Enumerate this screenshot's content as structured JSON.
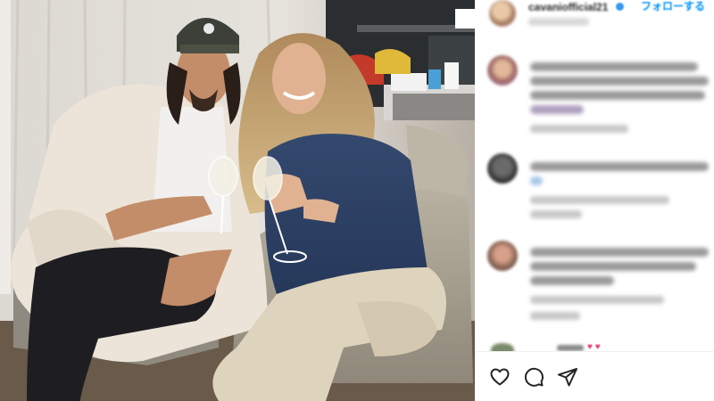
{
  "post": {
    "photo_alt": "",
    "username": "cavaniofficial21",
    "follow_label": "フォローする",
    "verified": true
  },
  "comments": [
    {
      "text": "",
      "meta": ""
    },
    {
      "text": "",
      "meta": ""
    },
    {
      "text": "",
      "meta": ""
    },
    {
      "text": "",
      "meta": ""
    }
  ],
  "reaction_emoji": "♥ ♥",
  "actions": {
    "like_icon": "heart-icon",
    "comment_icon": "speech-bubble-icon",
    "share_icon": "paper-plane-icon"
  },
  "colors": {
    "accent": "#0095f6",
    "text": "#262626",
    "border": "#efefef"
  }
}
